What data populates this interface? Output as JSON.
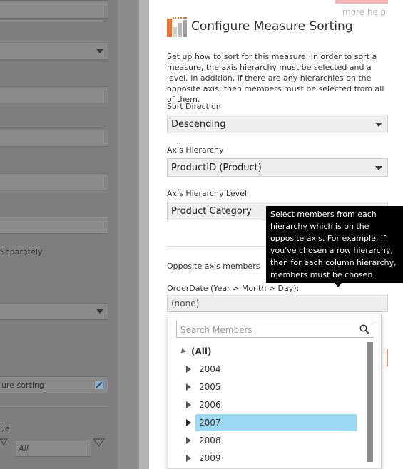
{
  "background": {
    "visible_texts": {
      "separately": "Separately",
      "measure_sorting": "ure sorting",
      "value_label": "ue",
      "all_value": "All"
    }
  },
  "dialog": {
    "more_help": "more help",
    "title": "Configure Measure Sorting",
    "description": "Set up how to sort for this measure. In order to sort a measure, the axis hierarchy must be selected and a level. In addition, if there are any hierarchies on the opposite axis, then members must be selected from all of them.",
    "sort_direction": {
      "label": "Sort Direction",
      "value": "Descending"
    },
    "axis_hierarchy": {
      "label": "Axis Hierarchy",
      "value": "ProductID (Product)"
    },
    "axis_hierarchy_level": {
      "label": "Axis Hierarchy Level",
      "value": "Product Category"
    },
    "opposite_axis_members": "Opposite axis members",
    "order_date_label": "OrderDate (Year > Month > Day):",
    "order_date_value": "(none)",
    "tooltip": "Select members from each hierarchy which is on the opposite axis. For example, if you've chosen a row hierarchy, then for each column hierarchy, members must be chosen."
  },
  "member_picker": {
    "search_placeholder": "Search Members",
    "root": "(All)",
    "items": [
      "2004",
      "2005",
      "2006",
      "2007",
      "2008",
      "2009"
    ],
    "selected": "2007"
  },
  "colors": {
    "accent_orange": "#e8763a",
    "selection_blue": "#9dd9f3",
    "tooltip_bg": "#000000"
  }
}
